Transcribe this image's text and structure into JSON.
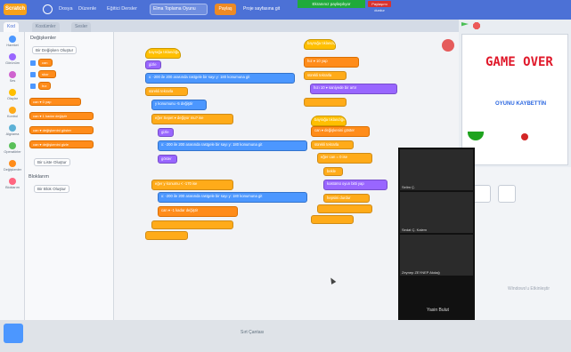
{
  "menu": {
    "logo": "Scratch",
    "items": [
      "Dosya",
      "Düzenle",
      "Eğitici Dersler"
    ],
    "project_title": "Elma Toplama Oyunu",
    "share_label": "Paylaş",
    "see_project_label": "Proje sayfasına git",
    "banner": "Ekranınız paylaşılıyor",
    "stop_label": "Paylaşımı durdur"
  },
  "tabs": [
    "Kod",
    "Kostümler",
    "Sesler"
  ],
  "categories": [
    {
      "label": "Hareket",
      "color": "#4c97ff"
    },
    {
      "label": "Görünüm",
      "color": "#9966ff"
    },
    {
      "label": "Ses",
      "color": "#cf63cf"
    },
    {
      "label": "Olaylar",
      "color": "#ffbf00"
    },
    {
      "label": "Kontrol",
      "color": "#ffab19"
    },
    {
      "label": "Algılama",
      "color": "#5cb1d6"
    },
    {
      "label": "Operatörler",
      "color": "#59c059"
    },
    {
      "label": "Değişkenler",
      "color": "#ff8c1a"
    },
    {
      "label": "Bloklarım",
      "color": "#ff6680"
    }
  ],
  "palette": {
    "heading": "Değişkenler",
    "make_var_button": "Bir Değişken Oluştur",
    "vars": [
      "can",
      "skor",
      "hız"
    ],
    "blocks": [
      "can ▾ 0 yap",
      "can ▾ 1 kadar değiştir",
      "can ▾ değişkenini göster",
      "can ▾ değişkenini gizle"
    ],
    "make_list_button": "Bir Liste Oluştur",
    "lists_heading": "Bloklarım",
    "make_block_button": "Bir Blok Oluştur"
  },
  "scripts": {
    "s1": [
      "bayrağa tıklandığında",
      "gizle",
      "x: -200 ile 200 arasında rastgele bir sayı y: 180 konumuna git",
      "sürekli tekrarla",
      "y konumunu -5 değiştir",
      "eğer Sepet ▾ değiyor mu? ise",
      "gizle",
      "x: -200 ile 200 arasında rastgele bir sayı y: 180 konumuna git",
      "göster",
      "eğer y konumu < -170 ise",
      "x: -200 ile 200 arasında rastgele bir sayı y: 180 konumuna git",
      "can ▾ -1 kadar değiştir"
    ],
    "s2": [
      "bayrağa tıklandığında",
      "hız ▾ 10 yap",
      "sürekli tekrarla",
      "hızı 10 ▾ saniyede bir artır"
    ],
    "s3": [
      "bayrağa tıklandığında",
      "can ▾ değişkenini göster",
      "sürekli tekrarla",
      "eğer can = 0 ise",
      "bekle",
      "kostümü oyun bitti yap",
      "hepsini durdur"
    ]
  },
  "stage": {
    "game_over": "GAME OVER",
    "lost_text": "OYUNU KAYBETTİN",
    "watermark": "Windows'u Etkinleştir"
  },
  "video": {
    "tiles": [
      "Selim Ç.",
      "Sedat Ç. Kalem",
      "Zeynep ZEYNEP Akdağ"
    ],
    "caption": "Yasin Bulut"
  },
  "footer": {
    "text": "Sırt Çantası"
  }
}
